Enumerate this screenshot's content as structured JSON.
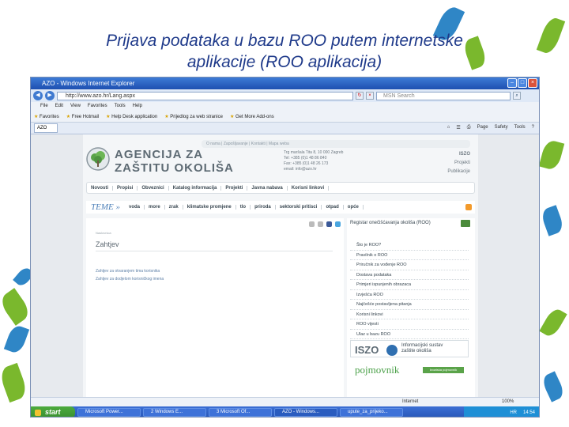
{
  "slide": {
    "title_line1": "Prijava podataka u bazu ROO putem internetske",
    "title_line2": "aplikacije (ROO aplikacija)"
  },
  "colors": {
    "title": "#1f3a8a",
    "leaf_green": "#7ab82d",
    "leaf_blue": "#2f86c6",
    "site_green": "#4aa048"
  },
  "browser": {
    "title": "AZO - Windows Internet Explorer",
    "url": "http://www.azo.hr/Lang.aspx",
    "search_placeholder": "MSN Search",
    "menu": [
      "File",
      "Edit",
      "View",
      "Favorites",
      "Tools",
      "Help"
    ],
    "favorites": [
      "Favorites",
      "Free Hotmail",
      "Help Desk application",
      "Prijedlog za web stranice",
      "Get More Add-ons"
    ],
    "tab": "AZO",
    "tab_tools": [
      "Page",
      "Safety",
      "Tools"
    ],
    "status": "Internet",
    "zoom": "100%"
  },
  "site": {
    "logo_line1": "AGENCIJA ZA",
    "logo_line2": "ZAŠTITU OKOLIŠA",
    "top_links": "O nama | Zapošljavanje | Kontakti | Mapa weba",
    "contact": [
      "Trg maršala Tita 8, 10 000 Zagreb",
      "Tel: +385 (0)1 48 86 840",
      "Fax: +385 (0)1 48 26 173",
      "email: info@azo.hr"
    ],
    "side_links": [
      "ISZO",
      "Projekti",
      "Publikacije"
    ],
    "main_nav": [
      "Novosti",
      "Propisi",
      "Obveznici",
      "Katalog informacija",
      "Projekti",
      "Javna nabava",
      "Korisni linkovi"
    ],
    "topics_label": "TEME »",
    "topics": [
      "voda",
      "more",
      "zrak",
      "klimatske promjene",
      "tlo",
      "priroda",
      "sektorski pritisci",
      "otpad",
      "opće"
    ],
    "crumb": "Naslovnica",
    "content_title": "Zahtjev",
    "content_links": [
      "Zahtjev za otvaranjem tima korisnika",
      "Zahtjev za dodjelom korisničkog imena"
    ],
    "sidebar_head": "Registar onečišćavanja okoliša (ROO)",
    "sidebar_items": [
      "Što je ROO?",
      "Pravilnik o ROO",
      "Priručnik za vođenje ROO",
      "Dostava podataka",
      "Primjeri ispunjenih obrazaca",
      "Izvješća ROO",
      "Najčešće postavljena pitanja",
      "Korisni linkovi",
      "ROO vijesti",
      "Ulaz u bazu ROO"
    ],
    "iszo": "ISZO",
    "iszo_desc_line1": "Informacijski sustav",
    "iszo_desc_line2": "zaštite okoliša",
    "pojmovnik": "pojmovnik",
    "pojmovnik_btn": "kroatska pojmovnik"
  },
  "taskbar": {
    "start": "start",
    "tasks": [
      "Microsoft Power...",
      "2 Windows E...",
      "3 Microsoft Of...",
      "AZO - Windows...",
      "upute_za_prijeko..."
    ],
    "lang": "HR",
    "time": "14:54"
  }
}
